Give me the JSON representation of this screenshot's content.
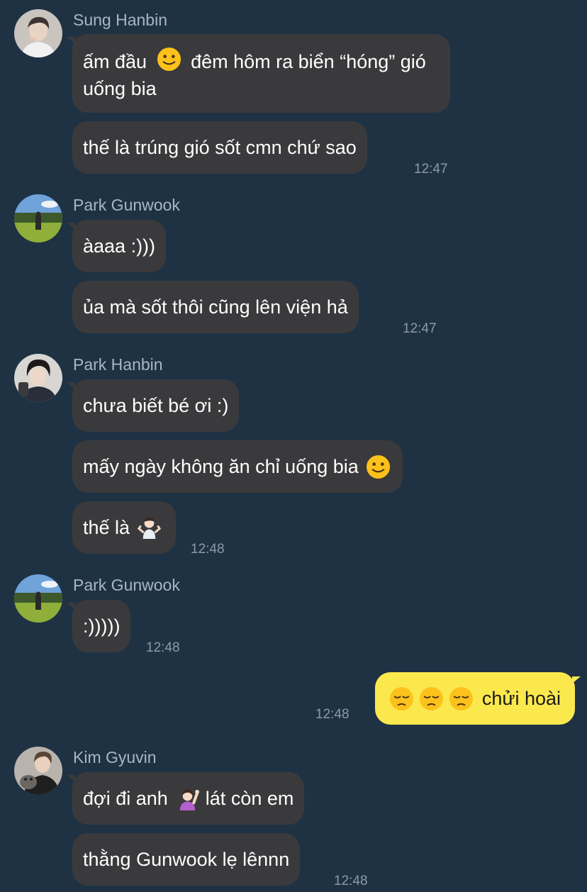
{
  "messages": [
    {
      "sender": "Sung Hanbin",
      "bubbles": [
        {
          "parts": [
            "ấm đầu",
            "slight-smile-emoji",
            "đêm hôm ra biển “hóng” gió uống bia"
          ]
        },
        {
          "parts": [
            "thế là trúng gió sốt cmn chứ sao"
          ]
        }
      ],
      "time": "12:47"
    },
    {
      "sender": "Park Gunwook",
      "bubbles": [
        {
          "parts": [
            "àaaa :)))"
          ]
        },
        {
          "parts": [
            "ủa mà sốt thôi cũng lên viện hả"
          ]
        }
      ],
      "time": "12:47"
    },
    {
      "sender": "Park Hanbin",
      "bubbles": [
        {
          "parts": [
            "chưa biết bé ơi :)"
          ]
        },
        {
          "parts": [
            "mấy ngày không ăn chỉ uống bia",
            "slight-smile-emoji"
          ]
        },
        {
          "parts": [
            "thế là",
            "person-shrugging-emoji"
          ]
        }
      ],
      "time": "12:48"
    },
    {
      "sender": "Park Gunwook",
      "bubbles": [
        {
          "parts": [
            ":)))))"
          ]
        }
      ],
      "time": "12:48"
    },
    {
      "sender": "me",
      "bubbles": [
        {
          "parts": [
            "pensive-emoji",
            "pensive-emoji",
            "pensive-emoji",
            "chửi hoài"
          ]
        }
      ],
      "time": "12:48"
    },
    {
      "sender": "Kim Gyuvin",
      "bubbles": [
        {
          "parts": [
            "đợi đi anh",
            "person-raising-hand-emoji",
            "lát còn em"
          ]
        },
        {
          "parts": [
            "thằng Gunwook lẹ lênnn"
          ]
        }
      ],
      "time": "12:48"
    }
  ],
  "colors": {
    "background": "#1e3244",
    "incoming_bubble": "#3a3a3c",
    "outgoing_bubble": "#fbe84d",
    "sender_name": "#a9b6c3",
    "timestamp": "#8d9aa6"
  }
}
